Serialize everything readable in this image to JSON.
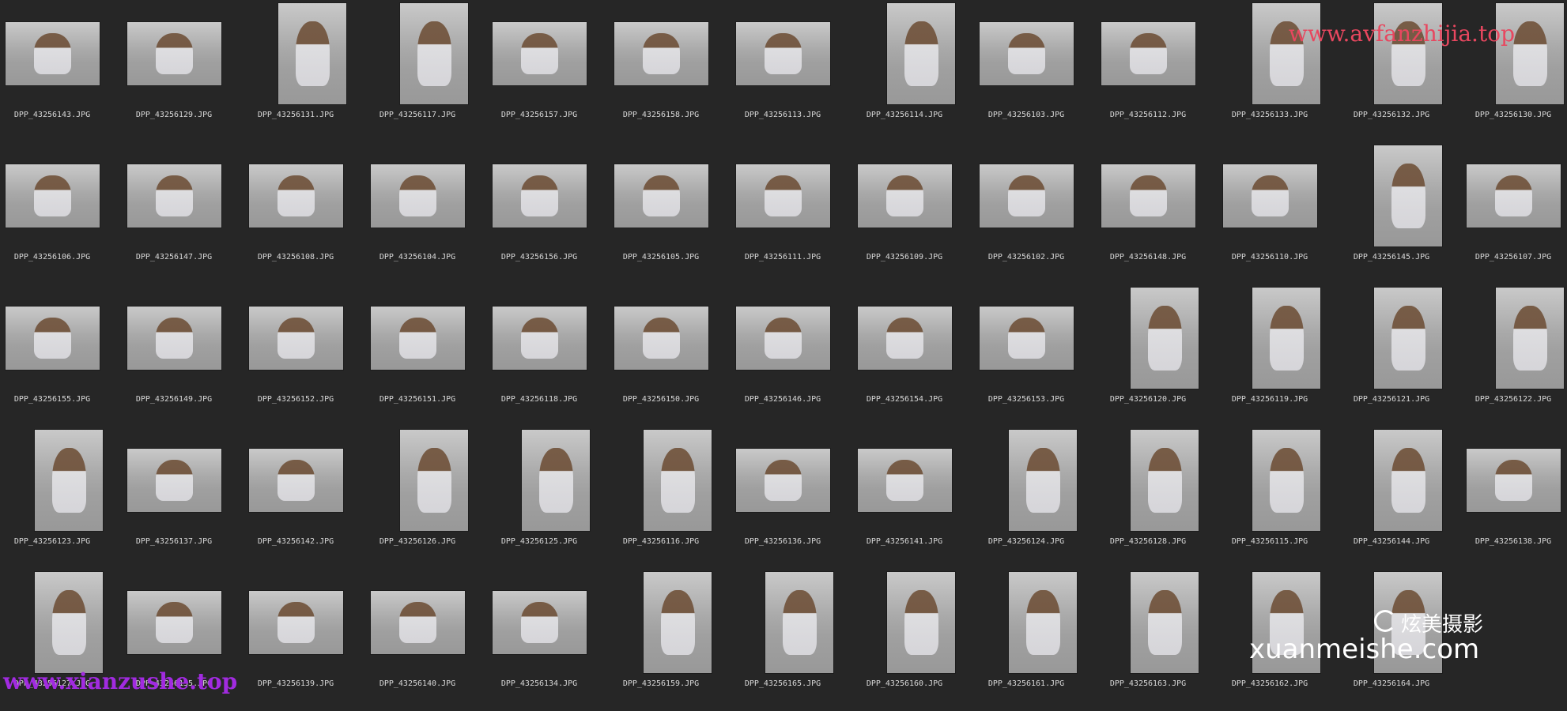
{
  "gallery": {
    "rows": [
      [
        "DPP_43256143.JPG",
        "DPP_43256129.JPG",
        "DPP_43256131.JPG",
        "DPP_43256117.JPG",
        "DPP_43256157.JPG",
        "DPP_43256158.JPG",
        "DPP_43256113.JPG",
        "DPP_43256114.JPG",
        "DPP_43256103.JPG",
        "DPP_43256112.JPG",
        "DPP_43256133.JPG",
        "DPP_43256132.JPG",
        "DPP_43256130.JPG"
      ],
      [
        "DPP_43256106.JPG",
        "DPP_43256147.JPG",
        "DPP_43256108.JPG",
        "DPP_43256104.JPG",
        "DPP_43256156.JPG",
        "DPP_43256105.JPG",
        "DPP_43256111.JPG",
        "DPP_43256109.JPG",
        "DPP_43256102.JPG",
        "DPP_43256148.JPG",
        "DPP_43256110.JPG",
        "DPP_43256145.JPG",
        "DPP_43256107.JPG"
      ],
      [
        "DPP_43256155.JPG",
        "DPP_43256149.JPG",
        "DPP_43256152.JPG",
        "DPP_43256151.JPG",
        "DPP_43256118.JPG",
        "DPP_43256150.JPG",
        "DPP_43256146.JPG",
        "DPP_43256154.JPG",
        "DPP_43256153.JPG",
        "DPP_43256120.JPG",
        "DPP_43256119.JPG",
        "DPP_43256121.JPG",
        "DPP_43256122.JPG"
      ],
      [
        "DPP_43256123.JPG",
        "DPP_43256137.JPG",
        "DPP_43256142.JPG",
        "DPP_43256126.JPG",
        "DPP_43256125.JPG",
        "DPP_43256116.JPG",
        "DPP_43256136.JPG",
        "DPP_43256141.JPG",
        "DPP_43256124.JPG",
        "DPP_43256128.JPG",
        "DPP_43256115.JPG",
        "DPP_43256144.JPG",
        "DPP_43256138.JPG"
      ],
      [
        "DPP_43256127.JPG",
        "DPP_43256135.JPG",
        "DPP_43256139.JPG",
        "DPP_43256140.JPG",
        "DPP_43256134.JPG",
        "DPP_43256159.JPG",
        "DPP_43256165.JPG",
        "DPP_43256160.JPG",
        "DPP_43256161.JPG",
        "DPP_43256163.JPG",
        "DPP_43256162.JPG",
        "DPP_43256164.JPG",
        ""
      ]
    ],
    "orientation": [
      [
        "l",
        "l",
        "p",
        "p",
        "l",
        "l",
        "l",
        "p",
        "l",
        "l",
        "p",
        "p",
        "p"
      ],
      [
        "l",
        "l",
        "l",
        "l",
        "l",
        "l",
        "l",
        "l",
        "l",
        "l",
        "l",
        "p",
        "l"
      ],
      [
        "l",
        "l",
        "l",
        "l",
        "l",
        "l",
        "l",
        "l",
        "l",
        "p",
        "p",
        "p",
        "p"
      ],
      [
        "p",
        "l",
        "l",
        "p",
        "p",
        "p",
        "l",
        "l",
        "p",
        "p",
        "p",
        "p",
        "l"
      ],
      [
        "p",
        "l",
        "l",
        "l",
        "l",
        "p",
        "p",
        "p",
        "p",
        "p",
        "p",
        "p",
        ""
      ]
    ]
  },
  "watermarks": {
    "top_right": "www.avfanzhijia.top",
    "bottom_left": "www.xianzushe.top",
    "brand_cn": "炫美摄影",
    "brand_en": "xuanmeishe.com"
  },
  "colors": {
    "background": "#262626",
    "label": "#d8d8d8",
    "watermark_top": "#e8475f",
    "watermark_bottom": "#a12be0"
  }
}
